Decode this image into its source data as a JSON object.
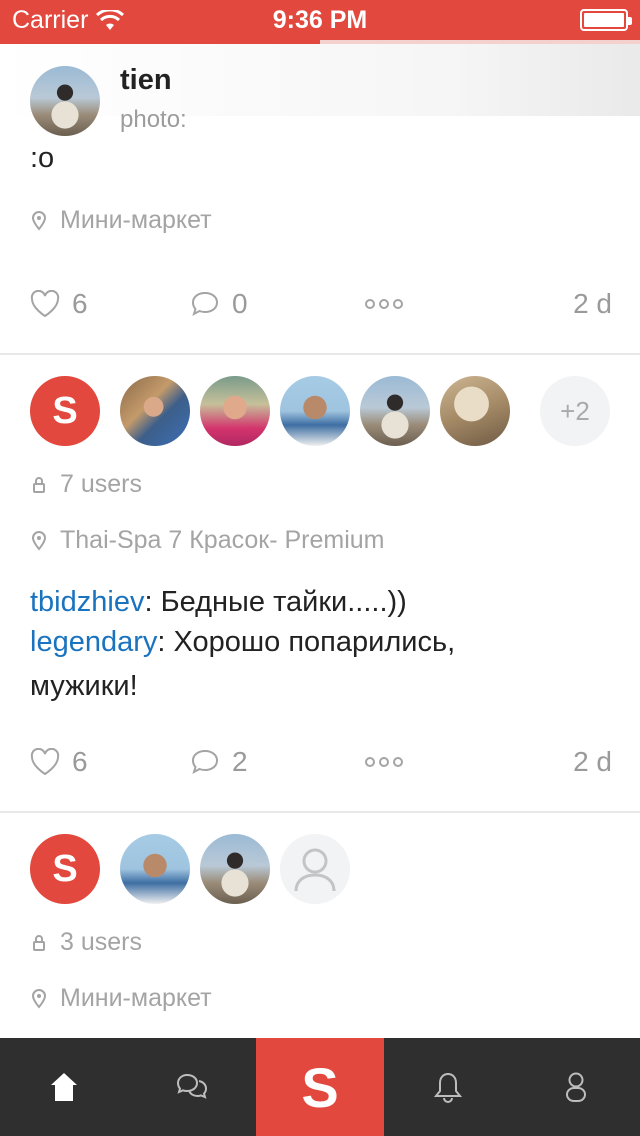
{
  "status_bar": {
    "carrier": "Carrier",
    "time": "9:36 PM",
    "battery_level": 1.0,
    "load_progress": 0.5
  },
  "feed": {
    "post1": {
      "username": "tien",
      "subtitle": "photo:",
      "text": ":o",
      "location": "Мини-маркет",
      "likes": "6",
      "comments": "0",
      "age": "2 d"
    },
    "post2": {
      "logo_letter": "S",
      "extra_count": "+2",
      "users": "7 users",
      "location": "Thai-Spa 7 Красок- Premium",
      "messages": [
        {
          "author": "tbidzhiev",
          "text": ": Бедные тайки.....))"
        },
        {
          "author": "legendary",
          "text": ": Хорошо попарились,"
        },
        {
          "author": "",
          "text": "мужики!"
        }
      ],
      "likes": "6",
      "comments": "2",
      "age": "2 d"
    },
    "post3": {
      "logo_letter": "S",
      "users": "3 users",
      "location": "Мини-маркет"
    }
  },
  "tabbar": {
    "main_label": "S"
  },
  "colors": {
    "accent": "#e2483d",
    "link": "#1a73bf",
    "tabbar_bg": "#2f2f2f"
  },
  "icons": [
    "wifi-icon",
    "battery-icon",
    "location-pin-icon",
    "heart-icon",
    "comment-icon",
    "more-icon",
    "lock-icon",
    "home-icon",
    "chat-icon",
    "bell-icon",
    "profile-icon"
  ]
}
